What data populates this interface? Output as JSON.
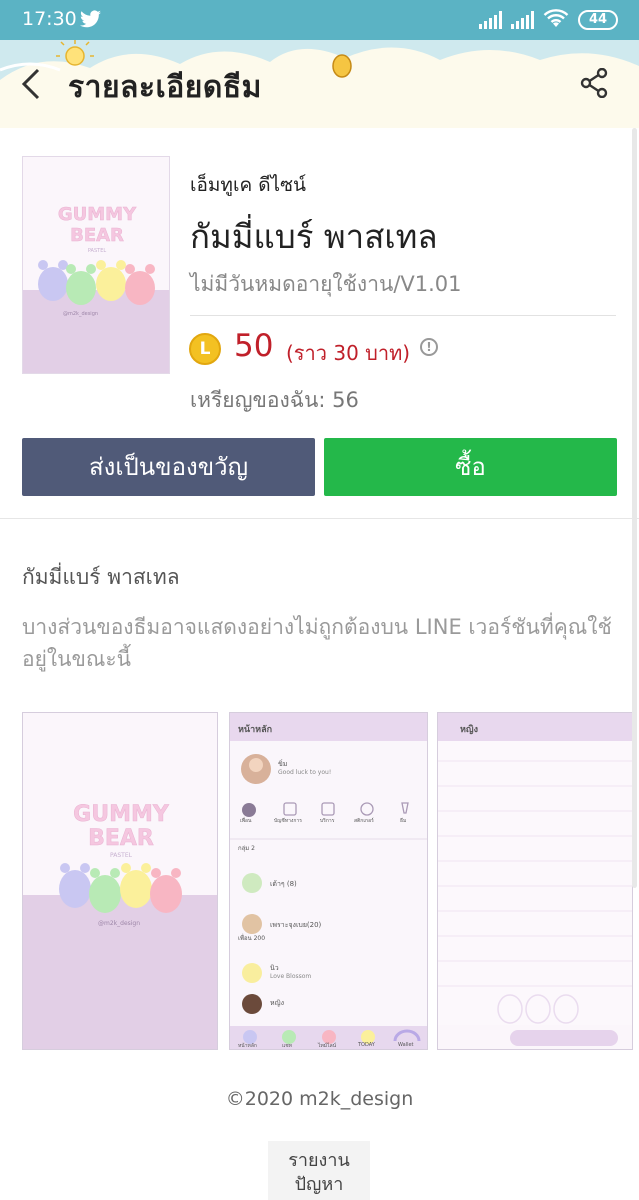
{
  "status_bar": {
    "time": "17:30",
    "battery": "44",
    "icons": [
      "twitter-icon",
      "signal-icon",
      "signal-icon",
      "wifi-icon",
      "battery-icon"
    ]
  },
  "header": {
    "title": "รายละเอียดธีม",
    "back_icon": "chevron-left-icon",
    "share_icon": "share-icon"
  },
  "theme": {
    "thumb_logo": "GUMMY\nBEAR",
    "thumb_sub": "PASTEL",
    "thumb_credit": "@m2k_design",
    "publisher": "เอ็มทูเค ดีไซน์",
    "name": "กัมมี่แบร์ พาสเทล",
    "expiry": "ไม่มีวันหมดอายุใช้งาน/V1.01",
    "coin_symbol": "L",
    "price": "50",
    "price_approx": "(ราว 30 บาท)",
    "my_coins": "เหรียญของฉัน: 56"
  },
  "buttons": {
    "gift": "ส่งเป็นของขวัญ",
    "buy": "ซื้อ"
  },
  "description": {
    "title": "กัมมี่แบร์ พาสเทล",
    "text": "บางส่วนของธีมอาจแสดงอย่างไม่ถูกต้องบน LINE เวอร์ชันที่คุณใช้อยู่ในขณะนี้"
  },
  "preview2": {
    "header": "หน้าหลัก",
    "profile_name": "ขิ่ม",
    "profile_status": "Good luck to you!",
    "tabs": [
      "เพื่อน",
      "บัญชีทางการ",
      "บริการ",
      "สติกเกอร์",
      "ธีม"
    ],
    "group_label": "กลุ่ม 2",
    "groups": [
      "เต้าๆ (8)",
      "เพราะจุงเบย(20)"
    ],
    "friends_label": "เพื่อน 200",
    "friends": [
      {
        "name": "นิว",
        "status": "Love Blossom"
      },
      {
        "name": "หญิง",
        "status": ""
      }
    ],
    "nav": [
      "หน้าหลัก",
      "แชท",
      "ไทม์ไลน์",
      "TODAY",
      "Wallet"
    ]
  },
  "preview3": {
    "header": "หญิง"
  },
  "copyright": "©2020 m2k_design",
  "report": "รายงาน\nปัญหา",
  "colors": {
    "status_bar": "#5bb3c4",
    "price": "#c0202a",
    "gift_button": "#505a78",
    "buy_button": "#24b84a",
    "coin": "#f3c122"
  }
}
